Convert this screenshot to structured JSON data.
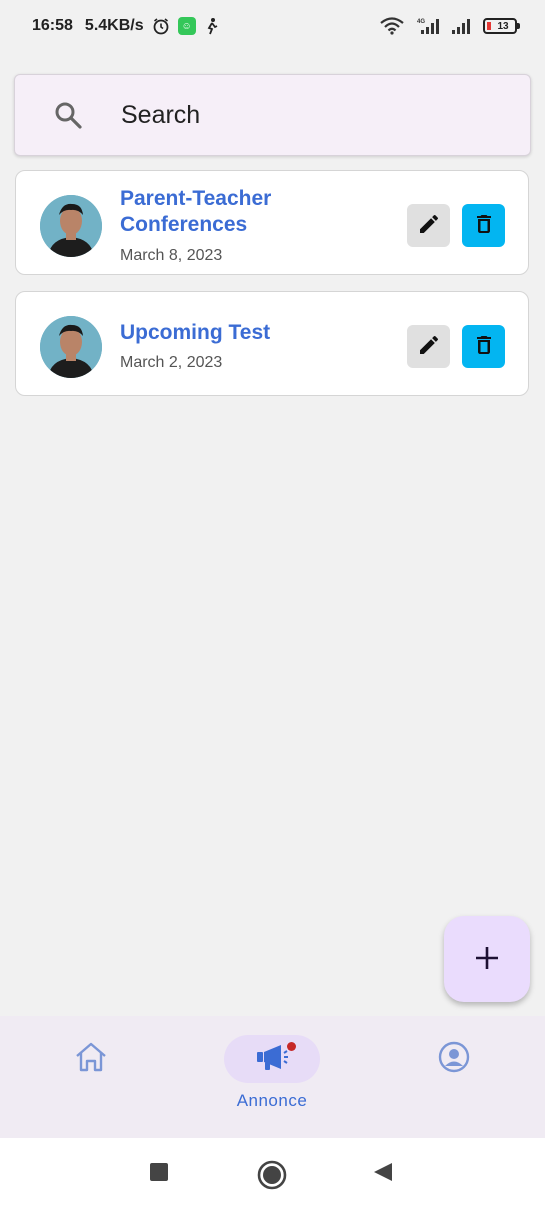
{
  "status_bar": {
    "time": "16:58",
    "network_speed": "5.4KB/s",
    "battery_level": "13",
    "icons": [
      "alarm-icon",
      "app-notification-icon",
      "runner-icon",
      "wifi-icon",
      "signal-4g-icon",
      "signal-icon",
      "battery-icon"
    ]
  },
  "search": {
    "placeholder": "Search"
  },
  "announcements": [
    {
      "title": "Parent-Teacher Conferences",
      "date": "March 8, 2023"
    },
    {
      "title": "Upcoming Test",
      "date": "March 2, 2023"
    }
  ],
  "bottom_nav": {
    "items": [
      {
        "icon": "home-icon",
        "label": "",
        "active": false
      },
      {
        "icon": "megaphone-icon",
        "label": "Annonce",
        "active": true
      },
      {
        "icon": "profile-icon",
        "label": "",
        "active": false
      }
    ]
  },
  "colors": {
    "accent": "#3b6cd4",
    "delete_button": "#03b5f1",
    "edit_button": "#e0e0e0",
    "fab": "#eadcfd",
    "nav_background": "#f0ebf3"
  }
}
